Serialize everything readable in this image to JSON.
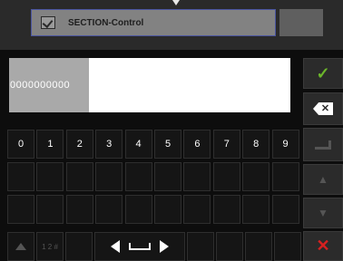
{
  "header": {
    "section_label": "SECTION-Control"
  },
  "input": {
    "selected_value": "0000000000"
  },
  "keyboard": {
    "digits": [
      "0",
      "1",
      "2",
      "3",
      "4",
      "5",
      "6",
      "7",
      "8",
      "9"
    ],
    "mode_label": "1 2 #"
  },
  "side_buttons": {
    "confirm_icon": "check-icon",
    "delete_icon": "backspace-icon",
    "enter_icon": "enter-icon",
    "up_icon": "arrow-up-icon",
    "down_icon": "arrow-down-icon",
    "cancel_icon": "close-icon"
  },
  "colors": {
    "confirm": "#6bb52b",
    "cancel": "#d62020",
    "selection": "#a9a9a9"
  }
}
